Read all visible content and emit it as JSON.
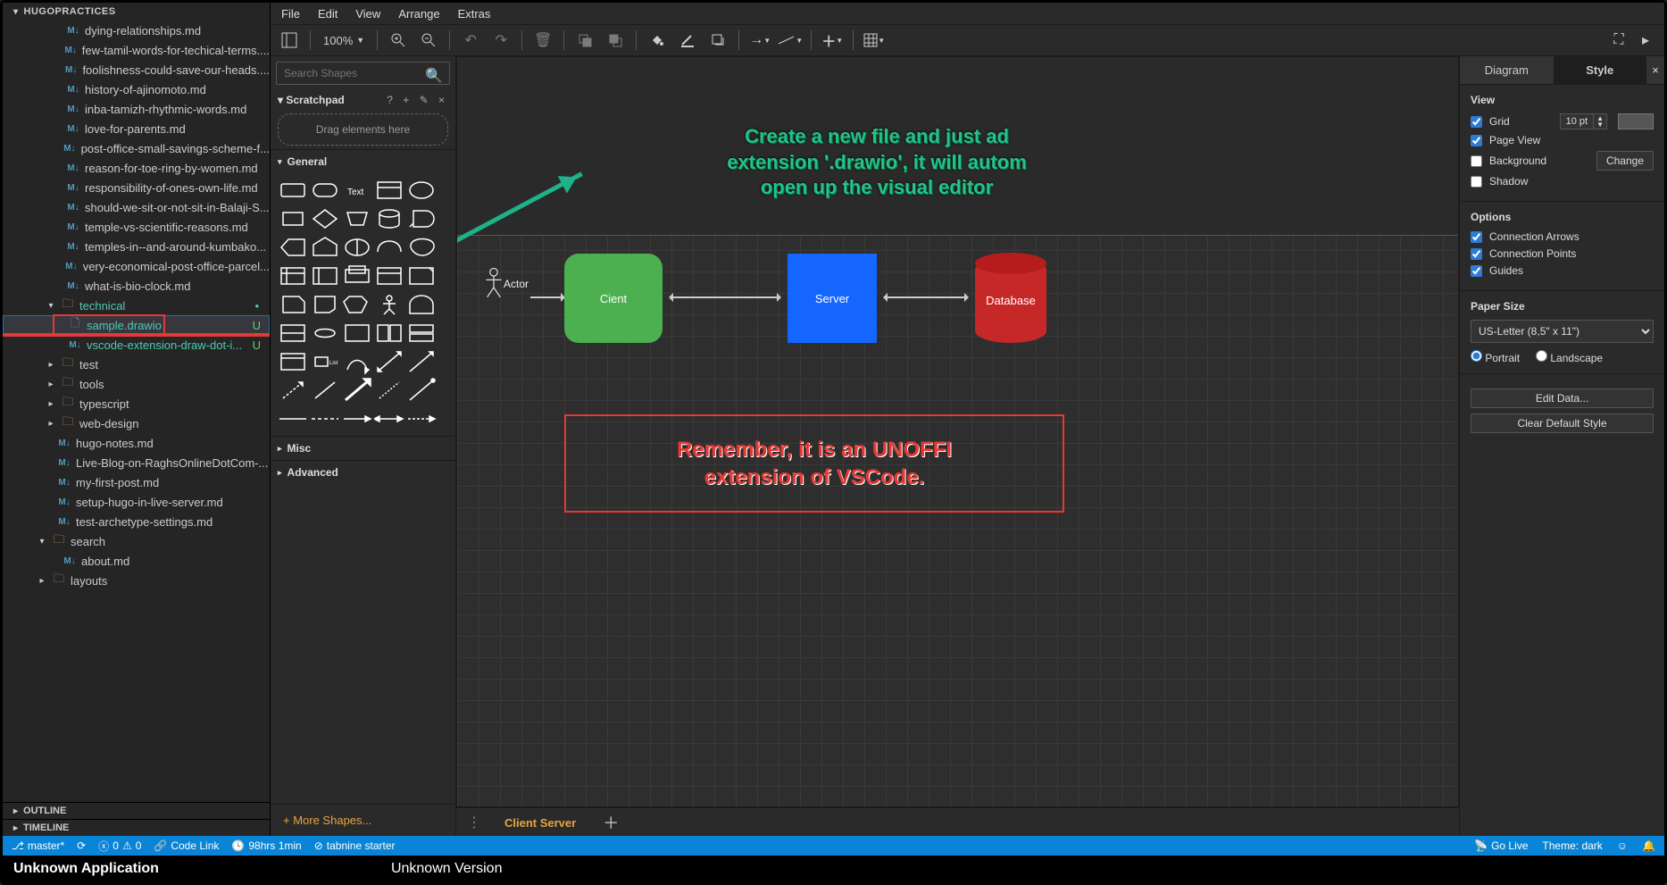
{
  "explorer": {
    "title": "HUGOPRACTICES",
    "files": [
      "dying-relationships.md",
      "few-tamil-words-for-techical-terms....",
      "foolishness-could-save-our-heads....",
      "history-of-ajinomoto.md",
      "inba-tamizh-rhythmic-words.md",
      "love-for-parents.md",
      "post-office-small-savings-scheme-f...",
      "reason-for-toe-ring-by-women.md",
      "responsibility-of-ones-own-life.md",
      "should-we-sit-or-not-sit-in-Balaji-S...",
      "temple-vs-scientific-reasons.md",
      "temples-in--and-around-kumbako...",
      "very-economical-post-office-parcel...",
      "what-is-bio-clock.md"
    ],
    "folders": {
      "technical": {
        "open": true,
        "children": [
          "sample.drawio",
          "vscode-extension-draw-dot-i..."
        ],
        "badge": "U"
      },
      "test": {},
      "tools": {},
      "typescript": {},
      "web-design": {}
    },
    "root_files": [
      "hugo-notes.md",
      "Live-Blog-on-RaghsOnlineDotCom-...",
      "my-first-post.md",
      "setup-hugo-in-live-server.md",
      "test-archetype-settings.md"
    ],
    "search_folder": {
      "name": "search",
      "children": [
        "about.md"
      ]
    },
    "layouts": "layouts",
    "panels": [
      "OUTLINE",
      "TIMELINE"
    ]
  },
  "menubar": [
    "File",
    "Edit",
    "View",
    "Arrange",
    "Extras"
  ],
  "zoom": "100%",
  "shapes": {
    "search_ph": "Search Shapes",
    "scratchpad": {
      "title": "Scratchpad",
      "drop": "Drag elements here",
      "tools": "?  +  ✎  ×"
    },
    "groups": [
      "General",
      "Misc",
      "Advanced"
    ],
    "more": "+  More Shapes..."
  },
  "canvas": {
    "actor_label": "Actor",
    "client": "Cient",
    "server": "Server",
    "db": "Database",
    "callout1": "Create a new file and just ad\nextension '.drawio', it will autom\nopen up the visual editor",
    "callout2": "Remember, it is an UNOFFI\nextension of VSCode.",
    "tab": "Client Server"
  },
  "format": {
    "tabs": [
      "Diagram",
      "Style"
    ],
    "view": {
      "title": "View",
      "grid": "Grid",
      "grid_val": "10 pt",
      "pageview": "Page View",
      "background": "Background",
      "change": "Change",
      "shadow": "Shadow"
    },
    "options": {
      "title": "Options",
      "ca": "Connection Arrows",
      "cp": "Connection Points",
      "g": "Guides"
    },
    "paper": {
      "title": "Paper Size",
      "sel": "US-Letter (8,5\" x 11\")",
      "portrait": "Portrait",
      "landscape": "Landscape"
    },
    "buttons": {
      "edit": "Edit Data...",
      "clear": "Clear Default Style"
    }
  },
  "status": {
    "branch": "master*",
    "errors": "0",
    "warnings": "0",
    "codelink": "Code Link",
    "time": "98hrs 1min",
    "tabnine": "tabnine starter",
    "golive": "Go Live",
    "theme": "Theme: dark"
  },
  "footer": {
    "app": "Unknown Application",
    "ver": "Unknown Version"
  },
  "chart_data": {
    "type": "diagram",
    "nodes": [
      {
        "id": "actor",
        "label": "Actor",
        "shape": "stick-figure"
      },
      {
        "id": "client",
        "label": "Cient",
        "shape": "rounded-rect",
        "fill": "#4caf50"
      },
      {
        "id": "server",
        "label": "Server",
        "shape": "rect",
        "fill": "#1565ff"
      },
      {
        "id": "database",
        "label": "Database",
        "shape": "cylinder",
        "fill": "#c62828"
      }
    ],
    "edges": [
      {
        "from": "actor",
        "to": "client",
        "dir": "one"
      },
      {
        "from": "client",
        "to": "server",
        "dir": "both"
      },
      {
        "from": "server",
        "to": "database",
        "dir": "both"
      }
    ]
  }
}
